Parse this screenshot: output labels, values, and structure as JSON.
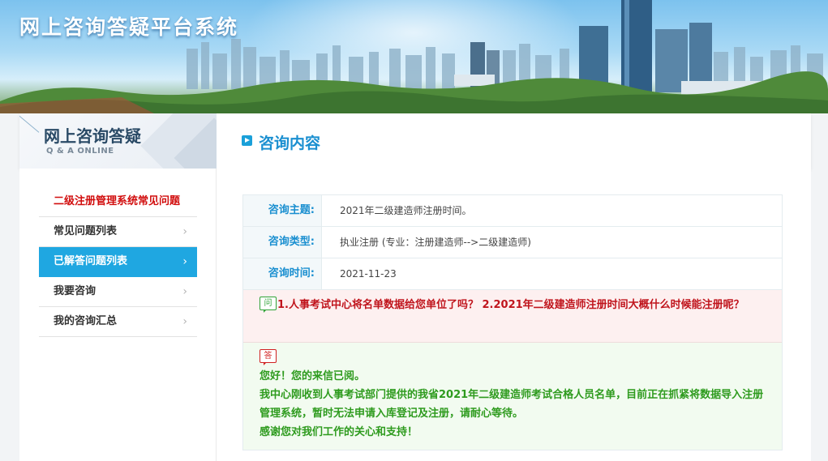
{
  "banner": {
    "title": "网上咨询答疑平台系统"
  },
  "header": {
    "qa_title": "网上咨询答疑",
    "qa_subtitle": "Q & A ONLINE",
    "section_title": "咨询内容"
  },
  "sidebar": {
    "items": [
      {
        "label": "二级注册管理系统常见问题",
        "state": "highlight-red"
      },
      {
        "label": "常见问题列表",
        "arrow": "›"
      },
      {
        "label": "已解答问题列表",
        "arrow": "›",
        "state": "active"
      },
      {
        "label": "我要咨询",
        "arrow": "›"
      },
      {
        "label": "我的咨询汇总",
        "arrow": "›"
      }
    ]
  },
  "consult": {
    "rows": [
      {
        "label": "咨询主题:",
        "value": "2021年二级建造师注册时间。"
      },
      {
        "label": "咨询类型:",
        "value": "执业注册 (专业：注册建造师-->二级建造师)"
      },
      {
        "label": "咨询时间:",
        "value": "2021-11-23"
      }
    ],
    "question_badge": "问",
    "question": "1.人事考试中心将名单数据给您单位了吗？ 2.2021年二级建造师注册时间大概什么时候能注册呢？",
    "answer_badge": "答",
    "answer_lines": [
      "您好！您的来信已阅。",
      "我中心刚收到人事考试部门提供的我省2021年二级建造师考试合格人员名单，目前正在抓紧将数据导入注册管理系统，暂时无法申请入库登记及注册，请耐心等待。",
      "感谢您对我们工作的关心和支持！"
    ]
  },
  "colors": {
    "accent_blue": "#1fa7e1",
    "title_blue": "#1a8fd0",
    "question_red": "#c0141c",
    "answer_green": "#2e9b1e"
  }
}
